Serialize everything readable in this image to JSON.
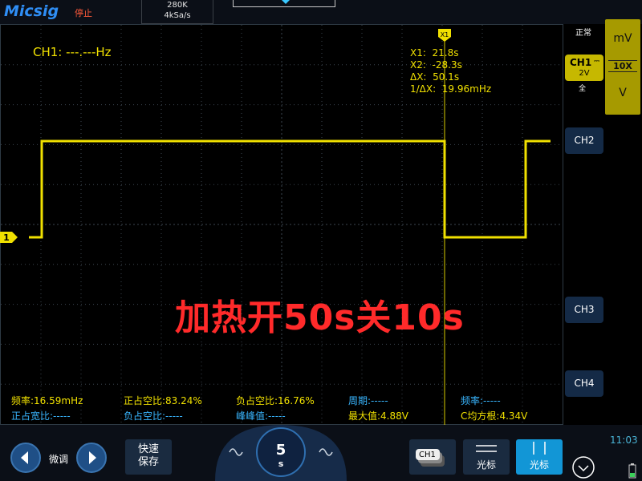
{
  "topbar": {
    "brand": "Micsig",
    "run_state": "停止",
    "memory_depth": "280K",
    "sample_rate": "4kSa/s"
  },
  "screen": {
    "freq_readout": "CH1: ---.---Hz",
    "cursor_marker_label": "X1",
    "cursors": [
      "X1:  21.8s",
      "X2:  -28.3s",
      "ΔX:  50.1s",
      "1/ΔX:  19.96mHz"
    ],
    "ch1_ground_marker": "1",
    "overlay_title": "加热开50s关10s",
    "measurements": [
      {
        "label": "频率:",
        "value": "16.59mHz",
        "color": "#f0e000"
      },
      {
        "label": "正占空比:",
        "value": "83.24%",
        "color": "#f0e000"
      },
      {
        "label": "负占空比:",
        "value": "16.76%",
        "color": "#f0e000"
      },
      {
        "label": "周期:",
        "value": "-----",
        "color": "#39b6ff"
      },
      {
        "label": "频率:",
        "value": "-----",
        "color": "#39b6ff"
      },
      {
        "label": "正占宽比:",
        "value": "-----",
        "color": "#39b6ff"
      },
      {
        "label": "负占空比:",
        "value": "-----",
        "color": "#39b6ff"
      },
      {
        "label": "峰峰值:",
        "value": "-----",
        "color": "#39b6ff"
      },
      {
        "label": "最大值:",
        "value": "4.88V",
        "color": "#f0e000"
      },
      {
        "label": "C均方根:",
        "value": "4.34V",
        "color": "#f0e000"
      }
    ]
  },
  "sidebar": {
    "trigger_mode": "正常",
    "ch1": {
      "label": "CH1",
      "scale": "2V",
      "coupling": "全"
    },
    "unit_panel": {
      "top": "mV",
      "probe": "10X",
      "bottom": "V"
    },
    "channels": [
      "CH2",
      "CH3",
      "CH4"
    ]
  },
  "bottombar": {
    "fine_label": "微调",
    "save_label_1": "快速",
    "save_label_2": "保存",
    "timebase_value": "5",
    "timebase_unit": "s",
    "ch1_stack_label": "CH1",
    "cursor_h_label": "光标",
    "cursor_v_label": "光标",
    "clock": "11:03"
  },
  "colors": {
    "trace": "#f0e000",
    "cursor": "#d8cc00",
    "grid": "#3c4650",
    "accent": "#1f4f86",
    "overlay": "#ff2a2a"
  },
  "waveform": {
    "time_per_div_s": 5,
    "volts_per_div": 2,
    "high_level_v": 4.88,
    "low_level_v": 0
  }
}
